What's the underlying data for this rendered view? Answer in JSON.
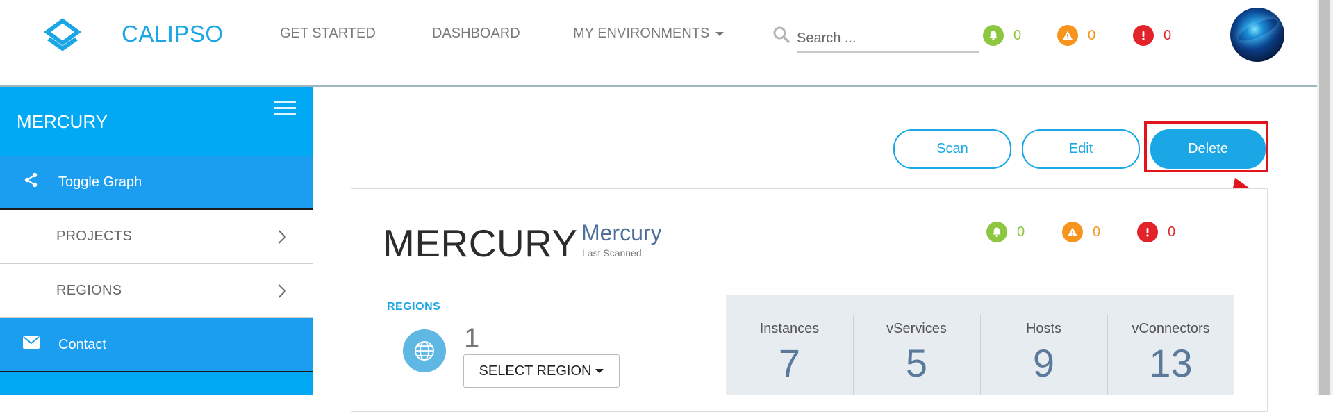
{
  "header": {
    "brand": "CALIPSO",
    "nav": [
      {
        "label": "GET STARTED"
      },
      {
        "label": "DASHBOARD"
      },
      {
        "label": "MY ENVIRONMENTS"
      }
    ],
    "search_placeholder": "Search ...",
    "status": {
      "notifications": "0",
      "warnings": "0",
      "errors": "0"
    }
  },
  "sidebar": {
    "title": "MERCURY",
    "items": [
      {
        "label": "Toggle Graph",
        "icon": "share-icon"
      },
      {
        "label": "PROJECTS"
      },
      {
        "label": "REGIONS"
      },
      {
        "label": "Contact",
        "icon": "envelope-icon"
      }
    ]
  },
  "actions": {
    "scan": "Scan",
    "edit": "Edit",
    "delete": "Delete"
  },
  "environment": {
    "name": "MERCURY",
    "display_name": "Mercury",
    "last_scanned": "Last Scanned:",
    "status": {
      "notifications": "0",
      "warnings": "0",
      "errors": "0"
    },
    "regions_label": "REGIONS",
    "region_count": "1",
    "select_region": "SELECT REGION",
    "stats": [
      {
        "label": "Instances",
        "value": "7"
      },
      {
        "label": "vServices",
        "value": "5"
      },
      {
        "label": "Hosts",
        "value": "9"
      },
      {
        "label": "vConnectors",
        "value": "13"
      }
    ]
  },
  "colors": {
    "accent": "#1ba7e6",
    "sidebar": "#01a9f4",
    "notification": "#8dc63f",
    "warning": "#f7941d",
    "error": "#e3232a",
    "highlight": "#e3131b"
  }
}
